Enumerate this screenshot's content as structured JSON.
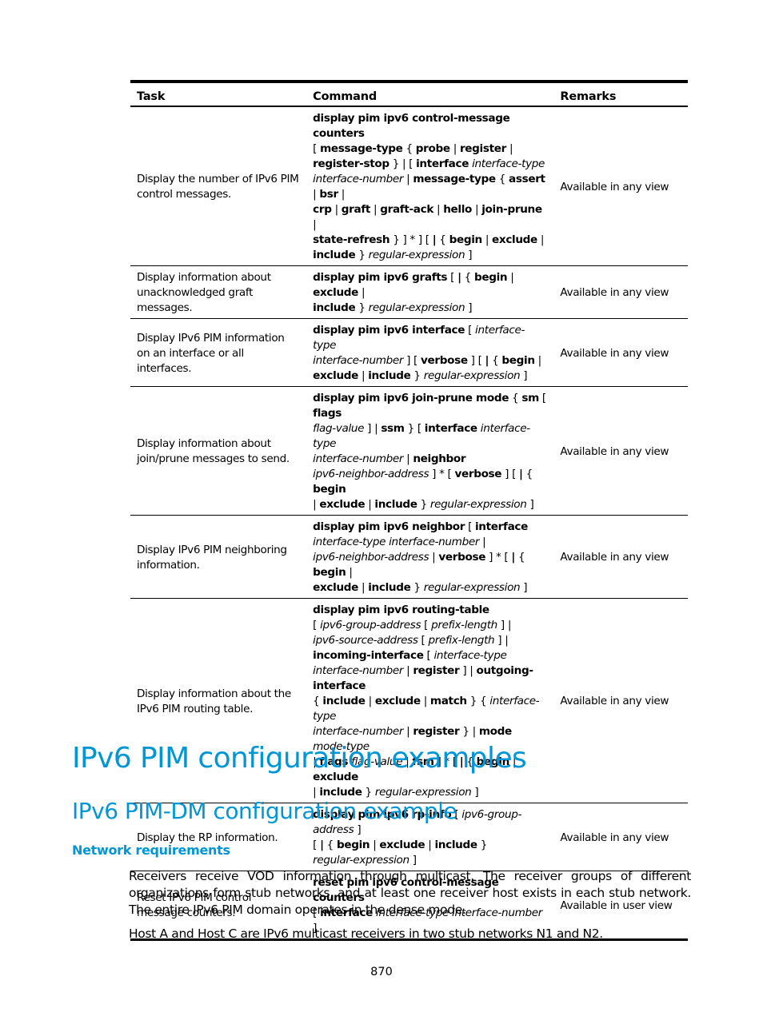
{
  "table": {
    "headers": [
      "Task",
      "Command",
      "Remarks"
    ],
    "rows": [
      {
        "task": "Display the number of IPv6 PIM control messages.",
        "command": [
          [
            "b",
            "display pim ipv6 control-message counters"
          ],
          [
            "br"
          ],
          [
            "t",
            "[ "
          ],
          [
            "b",
            "message-type"
          ],
          [
            "t",
            " { "
          ],
          [
            "b",
            "probe"
          ],
          [
            "t",
            " | "
          ],
          [
            "b",
            "register"
          ],
          [
            "t",
            " | "
          ],
          [
            "br"
          ],
          [
            "b",
            "register-stop"
          ],
          [
            "t",
            " } | [ "
          ],
          [
            "b",
            "interface"
          ],
          [
            "t",
            " "
          ],
          [
            "i",
            "interface-type"
          ],
          [
            "br"
          ],
          [
            "i",
            "interface-number"
          ],
          [
            "t",
            " | "
          ],
          [
            "b",
            "message-type"
          ],
          [
            "t",
            " { "
          ],
          [
            "b",
            "assert"
          ],
          [
            "t",
            " | "
          ],
          [
            "b",
            "bsr"
          ],
          [
            "t",
            " |"
          ],
          [
            "br"
          ],
          [
            "b",
            "crp"
          ],
          [
            "t",
            " | "
          ],
          [
            "b",
            "graft"
          ],
          [
            "t",
            " | "
          ],
          [
            "b",
            "graft-ack"
          ],
          [
            "t",
            " | "
          ],
          [
            "b",
            "hello"
          ],
          [
            "t",
            " | "
          ],
          [
            "b",
            "join-prune"
          ],
          [
            "t",
            " |"
          ],
          [
            "br"
          ],
          [
            "b",
            "state-refresh"
          ],
          [
            "t",
            " } ] * ] [ "
          ],
          [
            "b",
            "|"
          ],
          [
            "t",
            " { "
          ],
          [
            "b",
            "begin"
          ],
          [
            "t",
            " | "
          ],
          [
            "b",
            "exclude"
          ],
          [
            "t",
            " |"
          ],
          [
            "br"
          ],
          [
            "b",
            "include"
          ],
          [
            "t",
            " } "
          ],
          [
            "i",
            "regular-expression"
          ],
          [
            "t",
            " ]"
          ]
        ],
        "remarks": "Available in any view"
      },
      {
        "task": "Display information about unacknowledged graft messages.",
        "command": [
          [
            "b",
            "display pim ipv6 grafts"
          ],
          [
            "t",
            " [ "
          ],
          [
            "b",
            "|"
          ],
          [
            "t",
            " { "
          ],
          [
            "b",
            "begin"
          ],
          [
            "t",
            " | "
          ],
          [
            "b",
            "exclude"
          ],
          [
            "t",
            " |"
          ],
          [
            "br"
          ],
          [
            "b",
            "include"
          ],
          [
            "t",
            " } "
          ],
          [
            "i",
            "regular-expression"
          ],
          [
            "t",
            " ]"
          ]
        ],
        "remarks": "Available in any view"
      },
      {
        "task": "Display IPv6 PIM information on an interface or all interfaces.",
        "command": [
          [
            "b",
            "display pim ipv6 interface"
          ],
          [
            "t",
            " [ "
          ],
          [
            "i",
            "interface-type"
          ],
          [
            "br"
          ],
          [
            "i",
            "interface-number"
          ],
          [
            "t",
            " ] [ "
          ],
          [
            "b",
            "verbose"
          ],
          [
            "t",
            " ] [ "
          ],
          [
            "b",
            "|"
          ],
          [
            "t",
            " { "
          ],
          [
            "b",
            "begin"
          ],
          [
            "t",
            " |"
          ],
          [
            "br"
          ],
          [
            "b",
            "exclude"
          ],
          [
            "t",
            " | "
          ],
          [
            "b",
            "include"
          ],
          [
            "t",
            " } "
          ],
          [
            "i",
            "regular-expression"
          ],
          [
            "t",
            " ]"
          ]
        ],
        "remarks": "Available in any view"
      },
      {
        "task": "Display information about join/prune messages to send.",
        "command": [
          [
            "b",
            "display pim ipv6 join-prune mode"
          ],
          [
            "t",
            " { "
          ],
          [
            "b",
            "sm"
          ],
          [
            "t",
            " [ "
          ],
          [
            "b",
            "flags"
          ],
          [
            "br"
          ],
          [
            "i",
            "flag-value"
          ],
          [
            "t",
            " ] | "
          ],
          [
            "b",
            "ssm"
          ],
          [
            "t",
            " } [ "
          ],
          [
            "b",
            "interface"
          ],
          [
            "t",
            " "
          ],
          [
            "i",
            "interface-type"
          ],
          [
            "br"
          ],
          [
            "i",
            "interface-number"
          ],
          [
            "t",
            " | "
          ],
          [
            "b",
            "neighbor"
          ],
          [
            "br"
          ],
          [
            "i",
            "ipv6-neighbor-address"
          ],
          [
            "t",
            " ] * [ "
          ],
          [
            "b",
            "verbose"
          ],
          [
            "t",
            " ] [ "
          ],
          [
            "b",
            "|"
          ],
          [
            "t",
            " { "
          ],
          [
            "b",
            "begin"
          ],
          [
            "br"
          ],
          [
            "t",
            "| "
          ],
          [
            "b",
            "exclude"
          ],
          [
            "t",
            " | "
          ],
          [
            "b",
            "include"
          ],
          [
            "t",
            " } "
          ],
          [
            "i",
            "regular-expression"
          ],
          [
            "t",
            " ]"
          ]
        ],
        "remarks": "Available in any view"
      },
      {
        "task": "Display IPv6 PIM neighboring information.",
        "command": [
          [
            "b",
            "display pim ipv6 neighbor"
          ],
          [
            "t",
            " [ "
          ],
          [
            "b",
            "interface"
          ],
          [
            "br"
          ],
          [
            "i",
            "interface-type interface-number"
          ],
          [
            "t",
            " |"
          ],
          [
            "br"
          ],
          [
            "i",
            "ipv6-neighbor-address"
          ],
          [
            "t",
            " | "
          ],
          [
            "b",
            "verbose"
          ],
          [
            "t",
            " ] * [ "
          ],
          [
            "b",
            "|"
          ],
          [
            "t",
            " { "
          ],
          [
            "b",
            "begin"
          ],
          [
            "t",
            " |"
          ],
          [
            "br"
          ],
          [
            "b",
            "exclude"
          ],
          [
            "t",
            " | "
          ],
          [
            "b",
            "include"
          ],
          [
            "t",
            " } "
          ],
          [
            "i",
            "regular-expression"
          ],
          [
            "t",
            " ]"
          ]
        ],
        "remarks": "Available in any view"
      },
      {
        "task": "Display information about the IPv6 PIM routing table.",
        "command": [
          [
            "b",
            "display pim ipv6 routing-table"
          ],
          [
            "br"
          ],
          [
            "t",
            "[ "
          ],
          [
            "i",
            "ipv6-group-address"
          ],
          [
            "t",
            " [ "
          ],
          [
            "i",
            "prefix-length"
          ],
          [
            "t",
            " ] |"
          ],
          [
            "br"
          ],
          [
            "i",
            "ipv6-source-address"
          ],
          [
            "t",
            " [ "
          ],
          [
            "i",
            "prefix-length"
          ],
          [
            "t",
            " ] |"
          ],
          [
            "br"
          ],
          [
            "b",
            "incoming-interface"
          ],
          [
            "t",
            " [ "
          ],
          [
            "i",
            "interface-type"
          ],
          [
            "br"
          ],
          [
            "i",
            "interface-number"
          ],
          [
            "t",
            " | "
          ],
          [
            "b",
            "register"
          ],
          [
            "t",
            " ] | "
          ],
          [
            "b",
            "outgoing-interface"
          ],
          [
            "br"
          ],
          [
            "t",
            "{ "
          ],
          [
            "b",
            "include"
          ],
          [
            "t",
            " | "
          ],
          [
            "b",
            "exclude"
          ],
          [
            "t",
            " | "
          ],
          [
            "b",
            "match"
          ],
          [
            "t",
            " } { "
          ],
          [
            "i",
            "interface-type"
          ],
          [
            "br"
          ],
          [
            "i",
            "interface-number"
          ],
          [
            "t",
            " | "
          ],
          [
            "b",
            "register"
          ],
          [
            "t",
            " } | "
          ],
          [
            "b",
            "mode"
          ],
          [
            "t",
            " "
          ],
          [
            "i",
            "mode-type"
          ],
          [
            "br"
          ],
          [
            "t",
            "| "
          ],
          [
            "b",
            "flags"
          ],
          [
            "t",
            " "
          ],
          [
            "i",
            "flag-value"
          ],
          [
            "t",
            " | "
          ],
          [
            "b",
            "fsm"
          ],
          [
            "t",
            " ] * [ "
          ],
          [
            "b",
            "|"
          ],
          [
            "t",
            " { "
          ],
          [
            "b",
            "begin"
          ],
          [
            "t",
            " | "
          ],
          [
            "b",
            "exclude"
          ],
          [
            "br"
          ],
          [
            "t",
            "| "
          ],
          [
            "b",
            "include"
          ],
          [
            "t",
            " } "
          ],
          [
            "i",
            "regular-expression"
          ],
          [
            "t",
            " ]"
          ]
        ],
        "remarks": "Available in any view"
      },
      {
        "task": "Display the RP information.",
        "command": [
          [
            "b",
            "display pim ipv6 rp-info"
          ],
          [
            "t",
            " [ "
          ],
          [
            "i",
            "ipv6-group-address"
          ],
          [
            "t",
            " ]"
          ],
          [
            "br"
          ],
          [
            "t",
            "[ "
          ],
          [
            "b",
            "|"
          ],
          [
            "t",
            " { "
          ],
          [
            "b",
            "begin"
          ],
          [
            "t",
            " | "
          ],
          [
            "b",
            "exclude"
          ],
          [
            "t",
            " | "
          ],
          [
            "b",
            "include"
          ],
          [
            "t",
            " }"
          ],
          [
            "br"
          ],
          [
            "i",
            "regular-expression"
          ],
          [
            "t",
            " ]"
          ]
        ],
        "remarks": "Available in any view"
      },
      {
        "task": "Reset IPv6 PIM control message counters.",
        "command": [
          [
            "b",
            "reset pim ipv6 control-message counters"
          ],
          [
            "br"
          ],
          [
            "t",
            "[ "
          ],
          [
            "b",
            "interface"
          ],
          [
            "t",
            " "
          ],
          [
            "i",
            "interface-type interface-number"
          ],
          [
            "t",
            " ]"
          ]
        ],
        "remarks": "Available in user view"
      }
    ]
  },
  "headings": {
    "h1": "IPv6 PIM configuration examples",
    "h2": "IPv6 PIM-DM configuration example",
    "h3": "Network requirements"
  },
  "paragraphs": [
    "Receivers receive VOD information through multicast. The receiver groups of different organizations form stub networks, and at least one receiver host exists in each stub network. The entire IPv6 PIM domain operates in the dense mode.",
    "Host A and Host C are IPv6 multicast receivers in two stub networks N1 and N2."
  ],
  "page_number": "870",
  "colors": {
    "heading": "#0096d6",
    "text": "#000000"
  }
}
